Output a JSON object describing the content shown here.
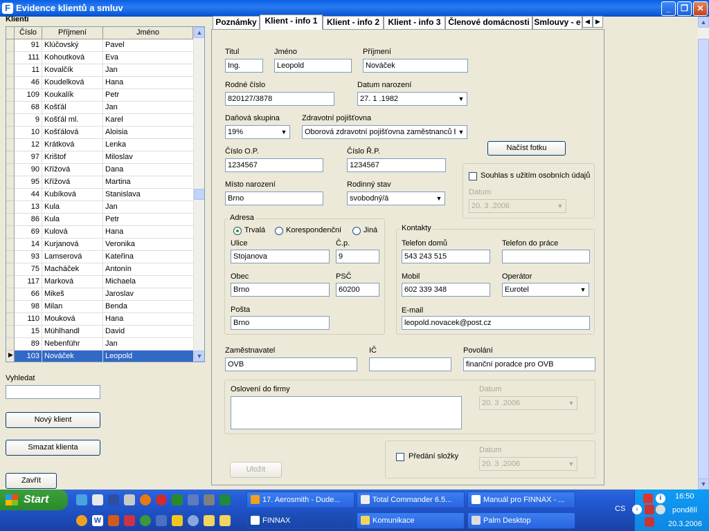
{
  "window": {
    "title": "Evidence klientů a smluv",
    "min": "_",
    "max": "❐",
    "close": "✕"
  },
  "clients_panel": {
    "label": "Klienti",
    "columns": [
      "Číslo",
      "Příjmení",
      "Jméno"
    ],
    "rows": [
      {
        "num": "91",
        "surname": "Klúčovský",
        "name": "Pavel"
      },
      {
        "num": "111",
        "surname": "Kohoutková",
        "name": "Eva"
      },
      {
        "num": "11",
        "surname": "Kovalčík",
        "name": "Jan"
      },
      {
        "num": "46",
        "surname": "Koudelková",
        "name": "Hana"
      },
      {
        "num": "109",
        "surname": "Koukalík",
        "name": "Petr"
      },
      {
        "num": "68",
        "surname": "Košťál",
        "name": "Jan"
      },
      {
        "num": "9",
        "surname": "Košťál ml.",
        "name": "Karel"
      },
      {
        "num": "10",
        "surname": "Košťálová",
        "name": "Aloisia"
      },
      {
        "num": "12",
        "surname": "Krátková",
        "name": "Lenka"
      },
      {
        "num": "97",
        "surname": "Krištof",
        "name": "Miloslav"
      },
      {
        "num": "90",
        "surname": "Křížová",
        "name": "Dana"
      },
      {
        "num": "95",
        "surname": "Křížová",
        "name": "Martina"
      },
      {
        "num": "44",
        "surname": "Kubíková",
        "name": "Stanislava"
      },
      {
        "num": "13",
        "surname": "Kula",
        "name": "Jan"
      },
      {
        "num": "86",
        "surname": "Kula",
        "name": "Petr"
      },
      {
        "num": "69",
        "surname": "Kulová",
        "name": "Hana"
      },
      {
        "num": "14",
        "surname": "Kurjanová",
        "name": "Veronika"
      },
      {
        "num": "93",
        "surname": "Lamserová",
        "name": "Kateřina"
      },
      {
        "num": "75",
        "surname": "Macháček",
        "name": "Antonín"
      },
      {
        "num": "117",
        "surname": "Marková",
        "name": "Michaela"
      },
      {
        "num": "66",
        "surname": "Mikeš",
        "name": "Jaroslav"
      },
      {
        "num": "98",
        "surname": "Milan",
        "name": "Benda"
      },
      {
        "num": "110",
        "surname": "Mouková",
        "name": "Hana"
      },
      {
        "num": "15",
        "surname": "Mühlhandl",
        "name": "David"
      },
      {
        "num": "89",
        "surname": "Nebenführ",
        "name": "Jan"
      },
      {
        "num": "103",
        "surname": "Nováček",
        "name": "Leopold"
      }
    ],
    "selected_index": 25,
    "search_label": "Vyhledat",
    "search_value": "",
    "new_client": "Nový klient",
    "delete_client": "Smazat klienta",
    "close": "Zavřít"
  },
  "tabs": [
    "Poznámky",
    "Klient - info 1",
    "Klient - info 2",
    "Klient - info 3",
    "Členové domácnosti",
    "Smlouvy - e"
  ],
  "active_tab": 1,
  "form": {
    "titul_label": "Titul",
    "titul": "Ing.",
    "jmeno_label": "Jméno",
    "jmeno": "Leopold",
    "prijmeni_label": "Příjmení",
    "prijmeni": "Nováček",
    "rc_label": "Rodné číslo",
    "rc": "820127/3878",
    "dn_label": "Datum narození",
    "dn": "27. 1 .1982",
    "dan_label": "Daňová skupina",
    "dan": "19%",
    "zp_label": "Zdravotní pojišťovna",
    "zp": "Oborová zdravotní pojišťovna zaměstnanců b",
    "op_label": "Číslo O.P.",
    "op": "1234567",
    "rp_label": "Číslo Ř.P.",
    "rp": "1234567",
    "photo_btn": "Načíst fotku",
    "consent_label": "Souhlas s užitím osobních údajů",
    "consent_date_label": "Datum",
    "consent_date": "20. 3 .2006",
    "mn_label": "Místo narození",
    "mn": "Brno",
    "rs_label": "Rodinný stav",
    "rs": "svobodný/á",
    "address": {
      "title": "Adresa",
      "types": [
        "Trvalá",
        "Korespondenční",
        "Jiná"
      ],
      "ulice_label": "Ulice",
      "ulice": "Stojanova",
      "cp_label": "Č.p.",
      "cp": "9",
      "obec_label": "Obec",
      "obec": "Brno",
      "psc_label": "PSČ",
      "psc": "60200",
      "posta_label": "Pošta",
      "posta": "Brno"
    },
    "contacts": {
      "title": "Kontakty",
      "tel_home_label": "Telefon domů",
      "tel_home": "543 243 515",
      "tel_work_label": "Telefon do práce",
      "tel_work": "",
      "mobil_label": "Mobil",
      "mobil": "602 339 348",
      "operator_label": "Operátor",
      "operator": "Eurotel",
      "email_label": "E-mail",
      "email": "leopold.novacek@post.cz"
    },
    "employer_label": "Zaměstnavatel",
    "employer": "OVB",
    "ic_label": "IČ",
    "ic": "",
    "job_label": "Povolání",
    "job": "finanční poradce pro OVB",
    "osloveni_label": "Oslovení do firmy",
    "osloveni": "",
    "osl_date_label": "Datum",
    "osl_date": "20. 3 .2006",
    "predani_label": "Předání složky",
    "pred_date_label": "Datum",
    "pred_date": "20. 3 .2006",
    "save": "Uložit"
  },
  "taskbar": {
    "start": "Start",
    "row1": [
      "17. Aerosmith - Dude...",
      "Total Commander 6.5...",
      "Manuál pro FINNAX - ..."
    ],
    "row2": [
      "FINNAX",
      "Komunikace",
      "Palm Desktop"
    ],
    "lang": "CS",
    "time": "16:50",
    "day": "pondělí",
    "date": "20.3.2006"
  }
}
